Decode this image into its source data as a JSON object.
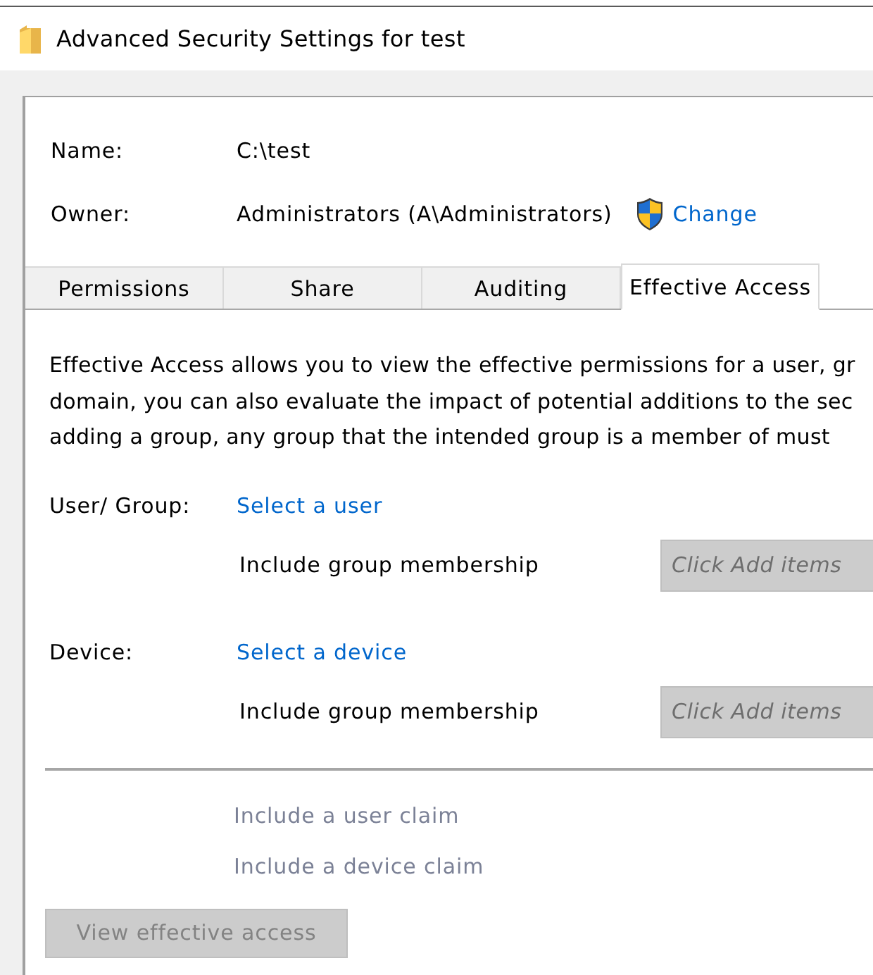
{
  "window": {
    "title": "Advanced Security Settings for test"
  },
  "details": [
    {
      "label": "Name:",
      "value": "C:\\test"
    },
    {
      "label": "Owner:",
      "value": "Administrators (A\\Administrators)",
      "action": "Change"
    }
  ],
  "tabs": [
    {
      "label": "Permissions",
      "selected": false
    },
    {
      "label": "Share",
      "selected": false
    },
    {
      "label": "Auditing",
      "selected": false
    },
    {
      "label": "Effective Access",
      "selected": true
    }
  ],
  "description": [
    "Effective Access allows you to view the effective permissions for a user, gr",
    "domain, you can also evaluate the impact of potential additions to the sec",
    "adding a group, any group that the intended group is a member of must"
  ],
  "principals": [
    {
      "label": "User/ Group:",
      "link": "Select a user",
      "membership_label": "Include group membership",
      "field": {
        "placeholder": "Click Add items",
        "disabled": true
      }
    },
    {
      "label": "Device:",
      "link": "Select a device",
      "membership_label": "Include group membership",
      "field": {
        "placeholder": "Click Add items",
        "disabled": true
      }
    }
  ],
  "claims": [
    {
      "label": "Include a user claim",
      "disabled": true
    },
    {
      "label": "Include a device claim",
      "disabled": true
    }
  ],
  "view_button": {
    "label": "View effective access",
    "disabled": true
  }
}
